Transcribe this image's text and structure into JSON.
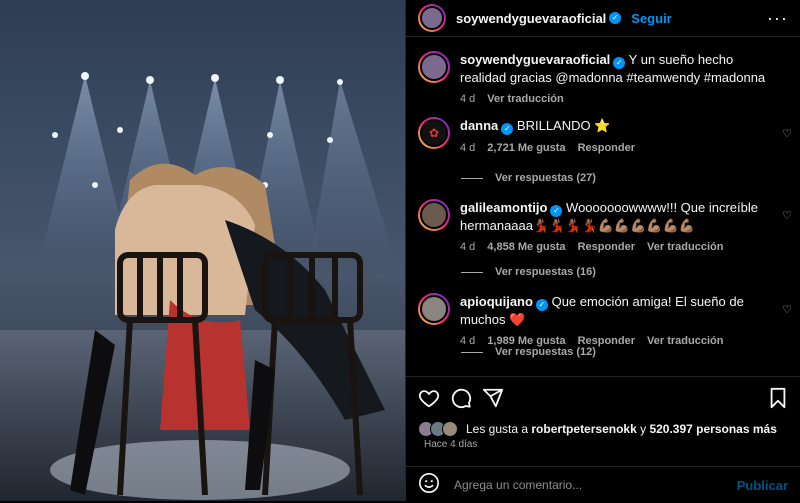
{
  "header": {
    "username": "soywendyguevaraoficial",
    "follow_label": "Seguir",
    "more_icon": "more-horizontal-icon"
  },
  "caption": {
    "username": "soywendyguevaraoficial",
    "text": "Y un sueño hecho realidad gracias @madonna #teamwendy #madonna",
    "time": "4 d",
    "translate": "Ver traducción"
  },
  "comments": [
    {
      "username": "danna",
      "text": "BRILLANDO ⭐",
      "time": "4 d",
      "likes": "2,721 Me gusta",
      "reply": "Responder",
      "translate": "",
      "view_replies": "Ver respuestas (27)"
    },
    {
      "username": "galileamontijo",
      "text": "Wooooooowwww!!! Que increíble hermanaaaa💃🏽💃🏽💃🏽💃🏽💪🏽💪🏽💪🏽💪🏽💪🏽💪🏽",
      "time": "4 d",
      "likes": "4,858 Me gusta",
      "reply": "Responder",
      "translate": "Ver traducción",
      "view_replies": "Ver respuestas (16)"
    },
    {
      "username": "apioquijano",
      "text": "Que emoción amiga! El sueño de muchos ❤️",
      "time": "4 d",
      "likes": "1,989 Me gusta",
      "reply": "Responder",
      "translate": "Ver traducción",
      "view_replies": "Ver respuestas (12)"
    }
  ],
  "likes": {
    "prefix": "Les gusta a",
    "user": "robertpetersenokk",
    "conj": "y",
    "count": "520.397 personas más"
  },
  "posted_ago": "Hace 4 días",
  "add_comment": {
    "placeholder": "Agrega un comentario...",
    "publish_label": "Publicar"
  },
  "icons": [
    "heart-icon",
    "comment-icon",
    "share-icon",
    "bookmark-icon",
    "emoji-icon"
  ],
  "colors": {
    "accent": "#0095f6",
    "background": "#000000",
    "muted": "#a8a8a8"
  }
}
